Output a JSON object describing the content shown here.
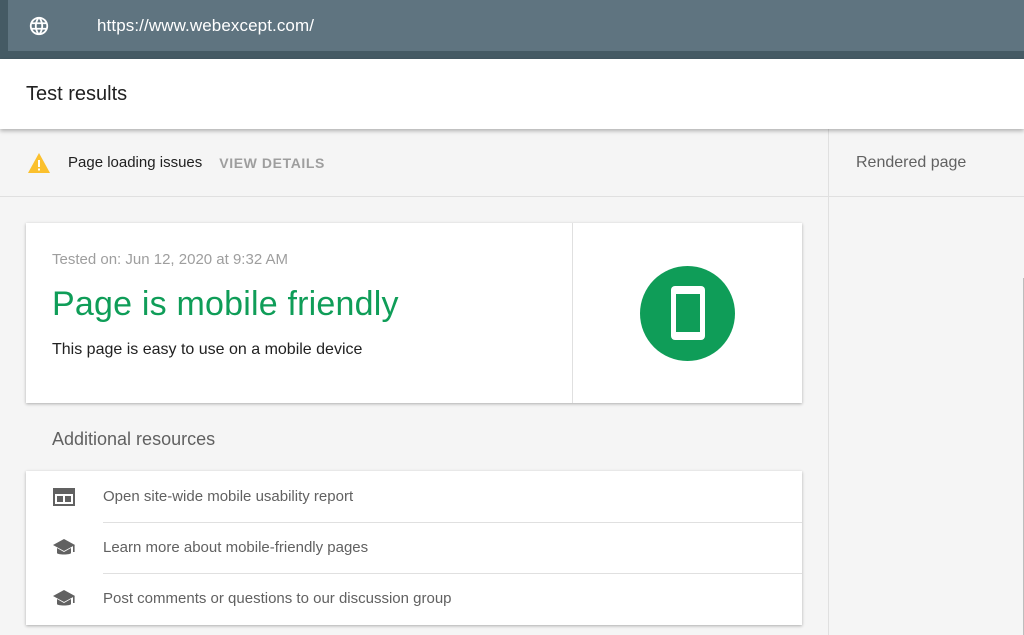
{
  "urlbar": {
    "url": "https://www.webexcept.com/",
    "icon": "globe-icon"
  },
  "header": {
    "title": "Test results"
  },
  "issues": {
    "text": "Page loading issues",
    "action": "VIEW DETAILS",
    "icon": "warning-icon"
  },
  "rendered": {
    "title": "Rendered page"
  },
  "result": {
    "tested_on": "Tested on: Jun 12, 2020 at 9:32 AM",
    "headline": "Page is mobile friendly",
    "subtext": "This page is easy to use on a mobile device",
    "icon": "mobile-phone-icon"
  },
  "resources": {
    "title": "Additional resources",
    "items": [
      {
        "label": "Open site-wide mobile usability report",
        "icon": "report-icon"
      },
      {
        "label": "Learn more about mobile-friendly pages",
        "icon": "school-icon"
      },
      {
        "label": "Post comments or questions to our discussion group",
        "icon": "school-icon"
      }
    ]
  },
  "colors": {
    "topbar": "#455a64",
    "url_field": "#5f7480",
    "success": "#0f9d58",
    "warning": "#fbc02d"
  }
}
